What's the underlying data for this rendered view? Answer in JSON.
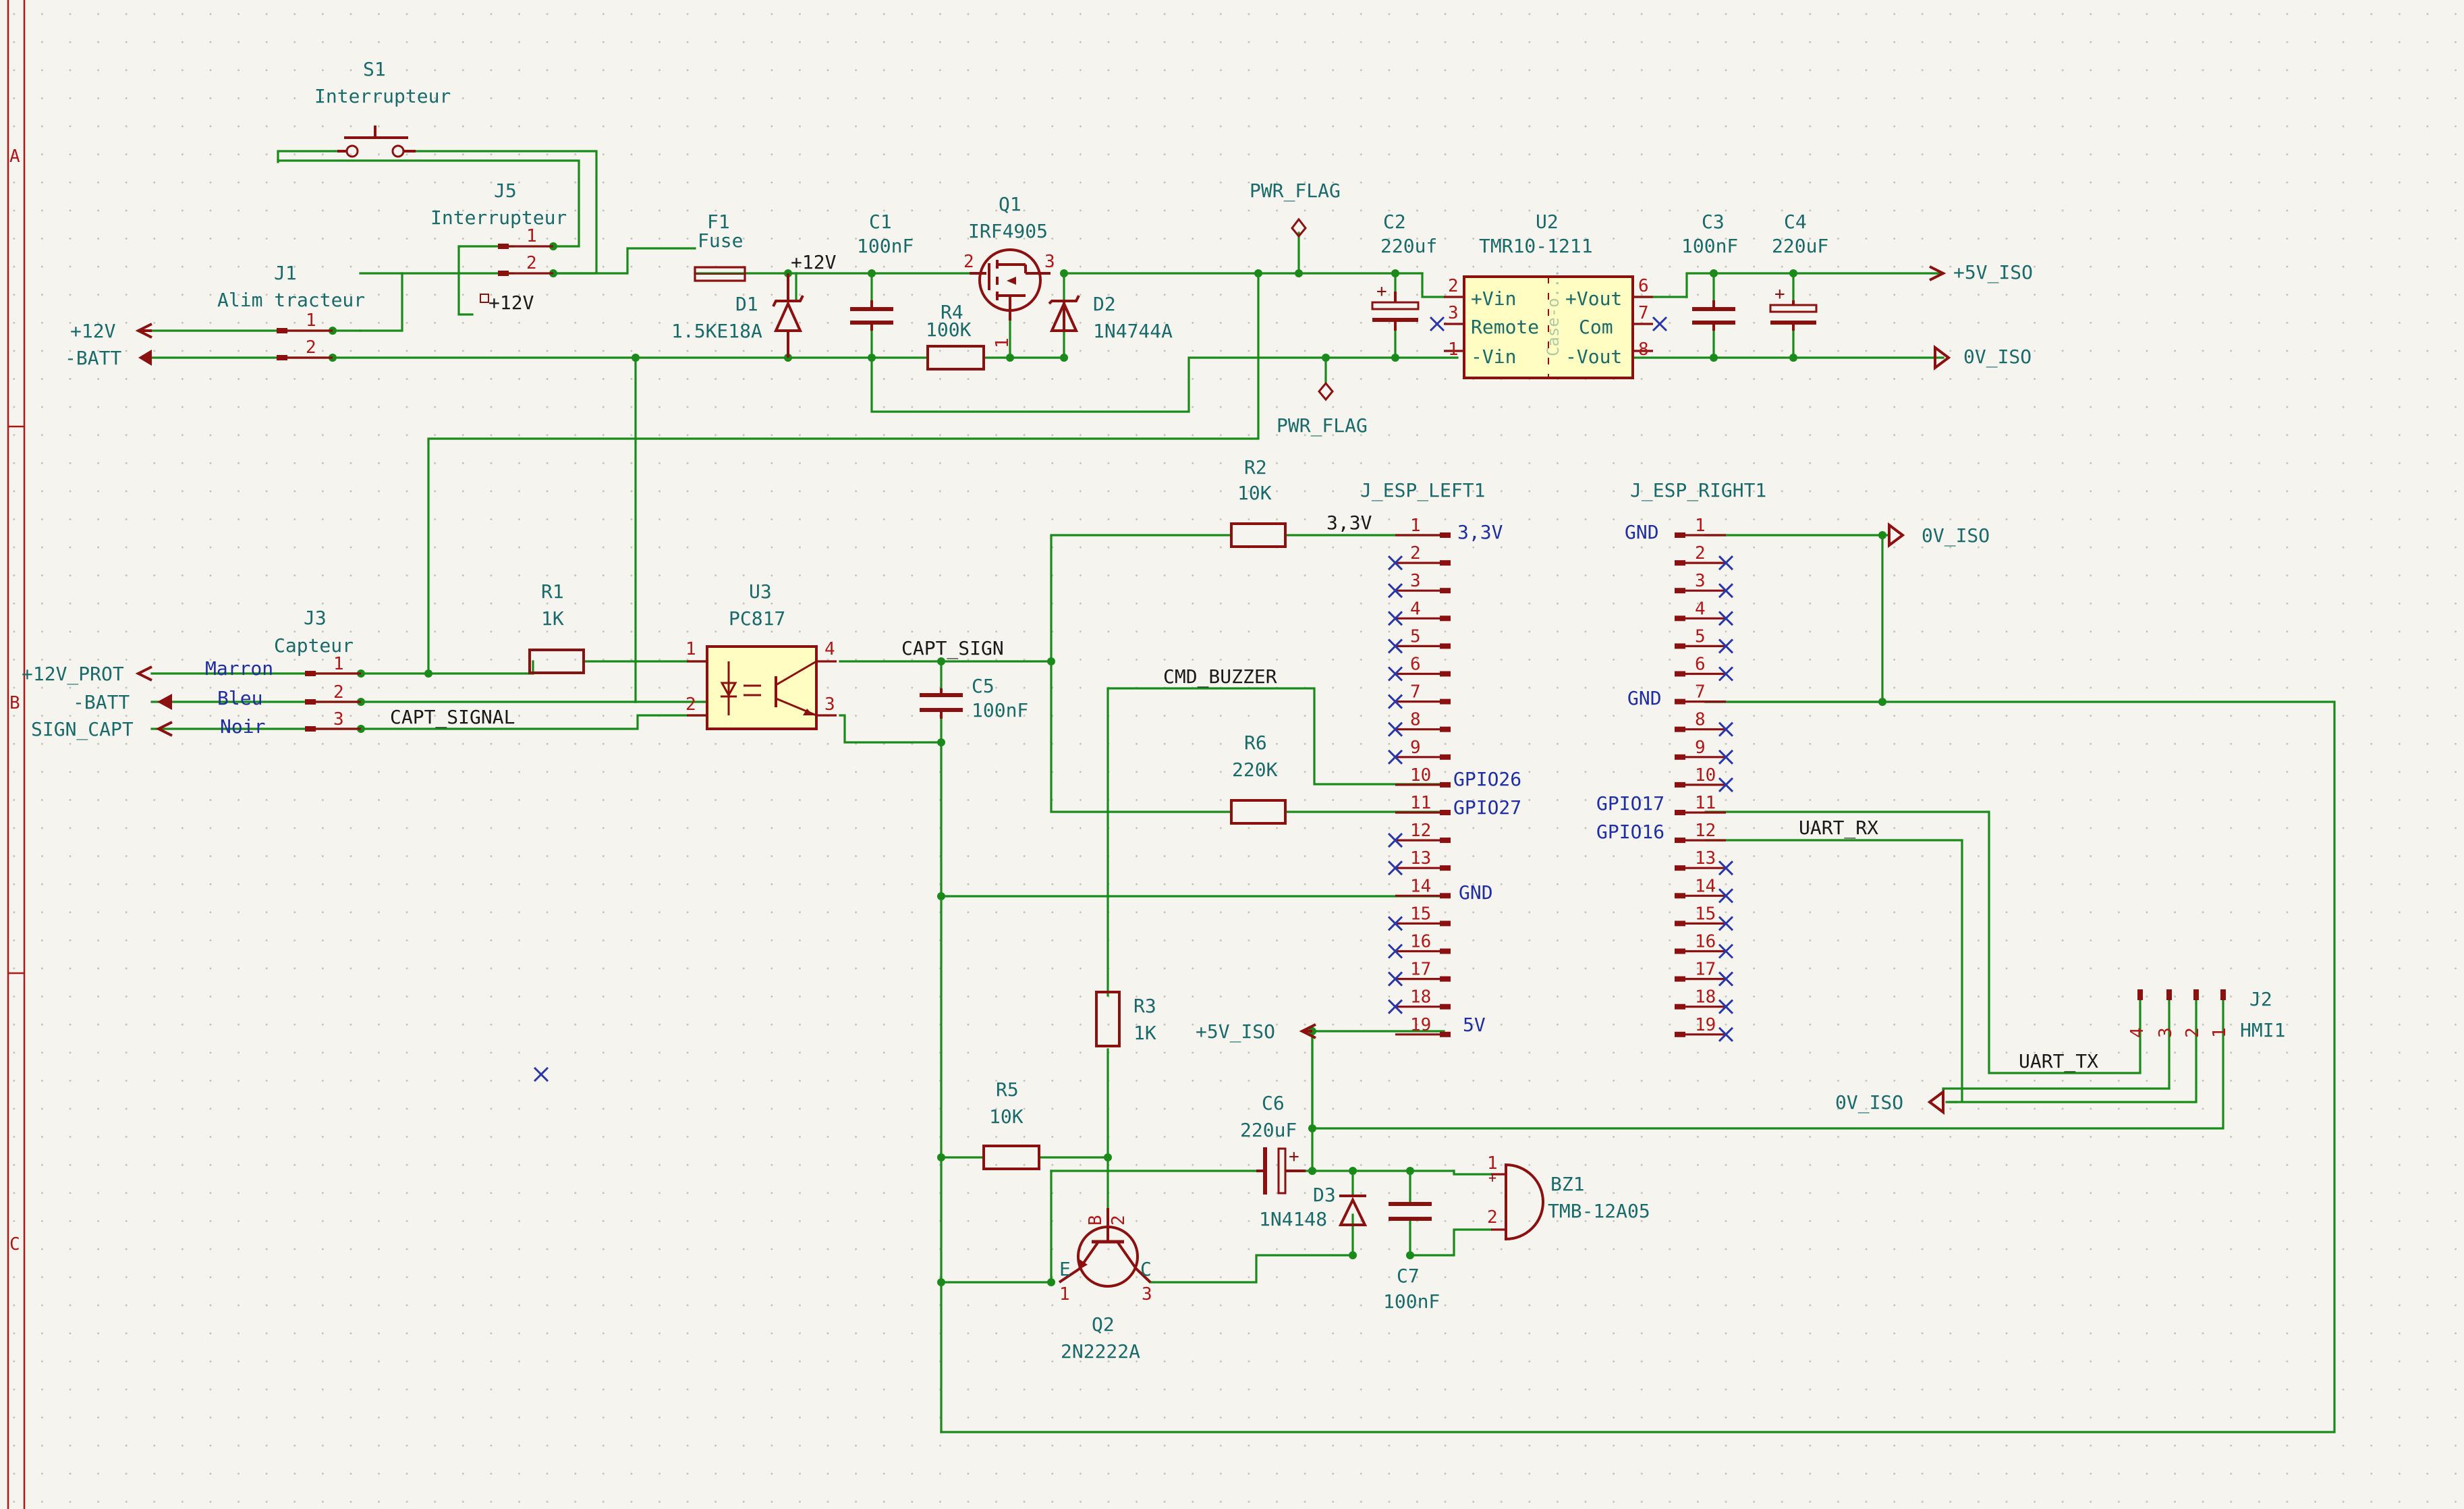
{
  "frame": {
    "rows": [
      "A",
      "B",
      "C"
    ]
  },
  "components": {
    "s1": {
      "ref": "S1",
      "value": "Interrupteur"
    },
    "j5": {
      "ref": "J5",
      "value": "Interrupteur",
      "pins": [
        "1",
        "2"
      ]
    },
    "j1": {
      "ref": "J1",
      "value": "Alim tracteur",
      "pins": [
        "1",
        "2"
      ]
    },
    "f1": {
      "ref": "F1",
      "value": "Fuse"
    },
    "c1": {
      "ref": "C1",
      "value": "100nF"
    },
    "d1": {
      "ref": "D1",
      "value": "1.5KE18A"
    },
    "r4": {
      "ref": "R4",
      "value": "100K"
    },
    "q1": {
      "ref": "Q1",
      "value": "IRF4905",
      "pins": [
        "2",
        "3",
        "1"
      ]
    },
    "d2": {
      "ref": "D2",
      "value": "1N4744A"
    },
    "c2": {
      "ref": "C2",
      "value": "220uf"
    },
    "u2": {
      "ref": "U2",
      "value": "TMR10-1211",
      "pins_left": [
        "2",
        "3",
        "1"
      ],
      "pins_right": [
        "6",
        "7",
        "8"
      ],
      "pin_names": [
        "+Vin",
        "Remote",
        "-Vin",
        "+Vout",
        "Com",
        "-Vout"
      ],
      "watermark": "Case-o..."
    },
    "c3": {
      "ref": "C3",
      "value": "100nF"
    },
    "c4": {
      "ref": "C4",
      "value": "220uF"
    },
    "j3": {
      "ref": "J3",
      "value": "Capteur",
      "pins": [
        "1",
        "2",
        "3"
      ],
      "wires": [
        "Marron",
        "Bleu",
        "Noir"
      ]
    },
    "r1": {
      "ref": "R1",
      "value": "1K"
    },
    "u3": {
      "ref": "U3",
      "value": "PC817",
      "pins": [
        "1",
        "2",
        "4",
        "3"
      ]
    },
    "c5": {
      "ref": "C5",
      "value": "100nF"
    },
    "r2": {
      "ref": "R2",
      "value": "10K"
    },
    "r6": {
      "ref": "R6",
      "value": "220K"
    },
    "r3": {
      "ref": "R3",
      "value": "1K"
    },
    "r5": {
      "ref": "R5",
      "value": "10K"
    },
    "c6": {
      "ref": "C6",
      "value": "220uF"
    },
    "d3": {
      "ref": "D3",
      "value": "1N4148"
    },
    "c7": {
      "ref": "C7",
      "value": "100nF"
    },
    "bz1": {
      "ref": "BZ1",
      "value": "TMB-12A05",
      "pins": [
        "1",
        "2"
      ]
    },
    "q2": {
      "ref": "Q2",
      "value": "2N2222A",
      "pins": [
        "B",
        "2",
        "E",
        "1",
        "C",
        "3"
      ]
    },
    "j2": {
      "ref": "J2",
      "value": "HMI1",
      "pins": [
        "4",
        "3",
        "2",
        "1"
      ]
    },
    "jl": {
      "ref": "J_ESP_LEFT1",
      "pins": [
        "1",
        "2",
        "3",
        "4",
        "5",
        "6",
        "7",
        "8",
        "9",
        "10",
        "11",
        "12",
        "13",
        "14",
        "15",
        "16",
        "17",
        "18",
        "19"
      ],
      "names": {
        "p1": "3,3V",
        "p10": "GPIO26",
        "p11": "GPIO27",
        "p14": "GND",
        "p19": "5V"
      }
    },
    "jr": {
      "ref": "J_ESP_RIGHT1",
      "pins": [
        "1",
        "2",
        "3",
        "4",
        "5",
        "6",
        "7",
        "8",
        "9",
        "10",
        "11",
        "12",
        "13",
        "14",
        "15",
        "16",
        "17",
        "18",
        "19"
      ],
      "names": {
        "p1": "GND",
        "p7": "GND",
        "p11": "GPIO17",
        "p12": "GPIO16"
      }
    }
  },
  "power": {
    "p12v": "+12V",
    "batt": "-BATT",
    "p12v_prot": "+12V_PROT",
    "batt2": "-BATT",
    "sign_capt": "SIGN_CAPT",
    "p5v_iso": "+5V_ISO",
    "ov_iso_a": "0V_ISO",
    "ov_iso_b": "0V_ISO",
    "ov_iso_c": "0V_ISO",
    "p5v_iso_b": "+5V_ISO",
    "pwr_flag_a": "PWR_FLAG",
    "pwr_flag_b": "PWR_FLAG"
  },
  "nets": {
    "n12v_a": "+12V",
    "n12v_b": "+12V",
    "n33v": "3,3V",
    "capt_sign": "CAPT_SIGN",
    "capt_signal": "CAPT_SIGNAL",
    "cmd_buzzer": "CMD_BUZZER",
    "uart_rx": "UART_RX",
    "uart_tx": "UART_TX"
  }
}
